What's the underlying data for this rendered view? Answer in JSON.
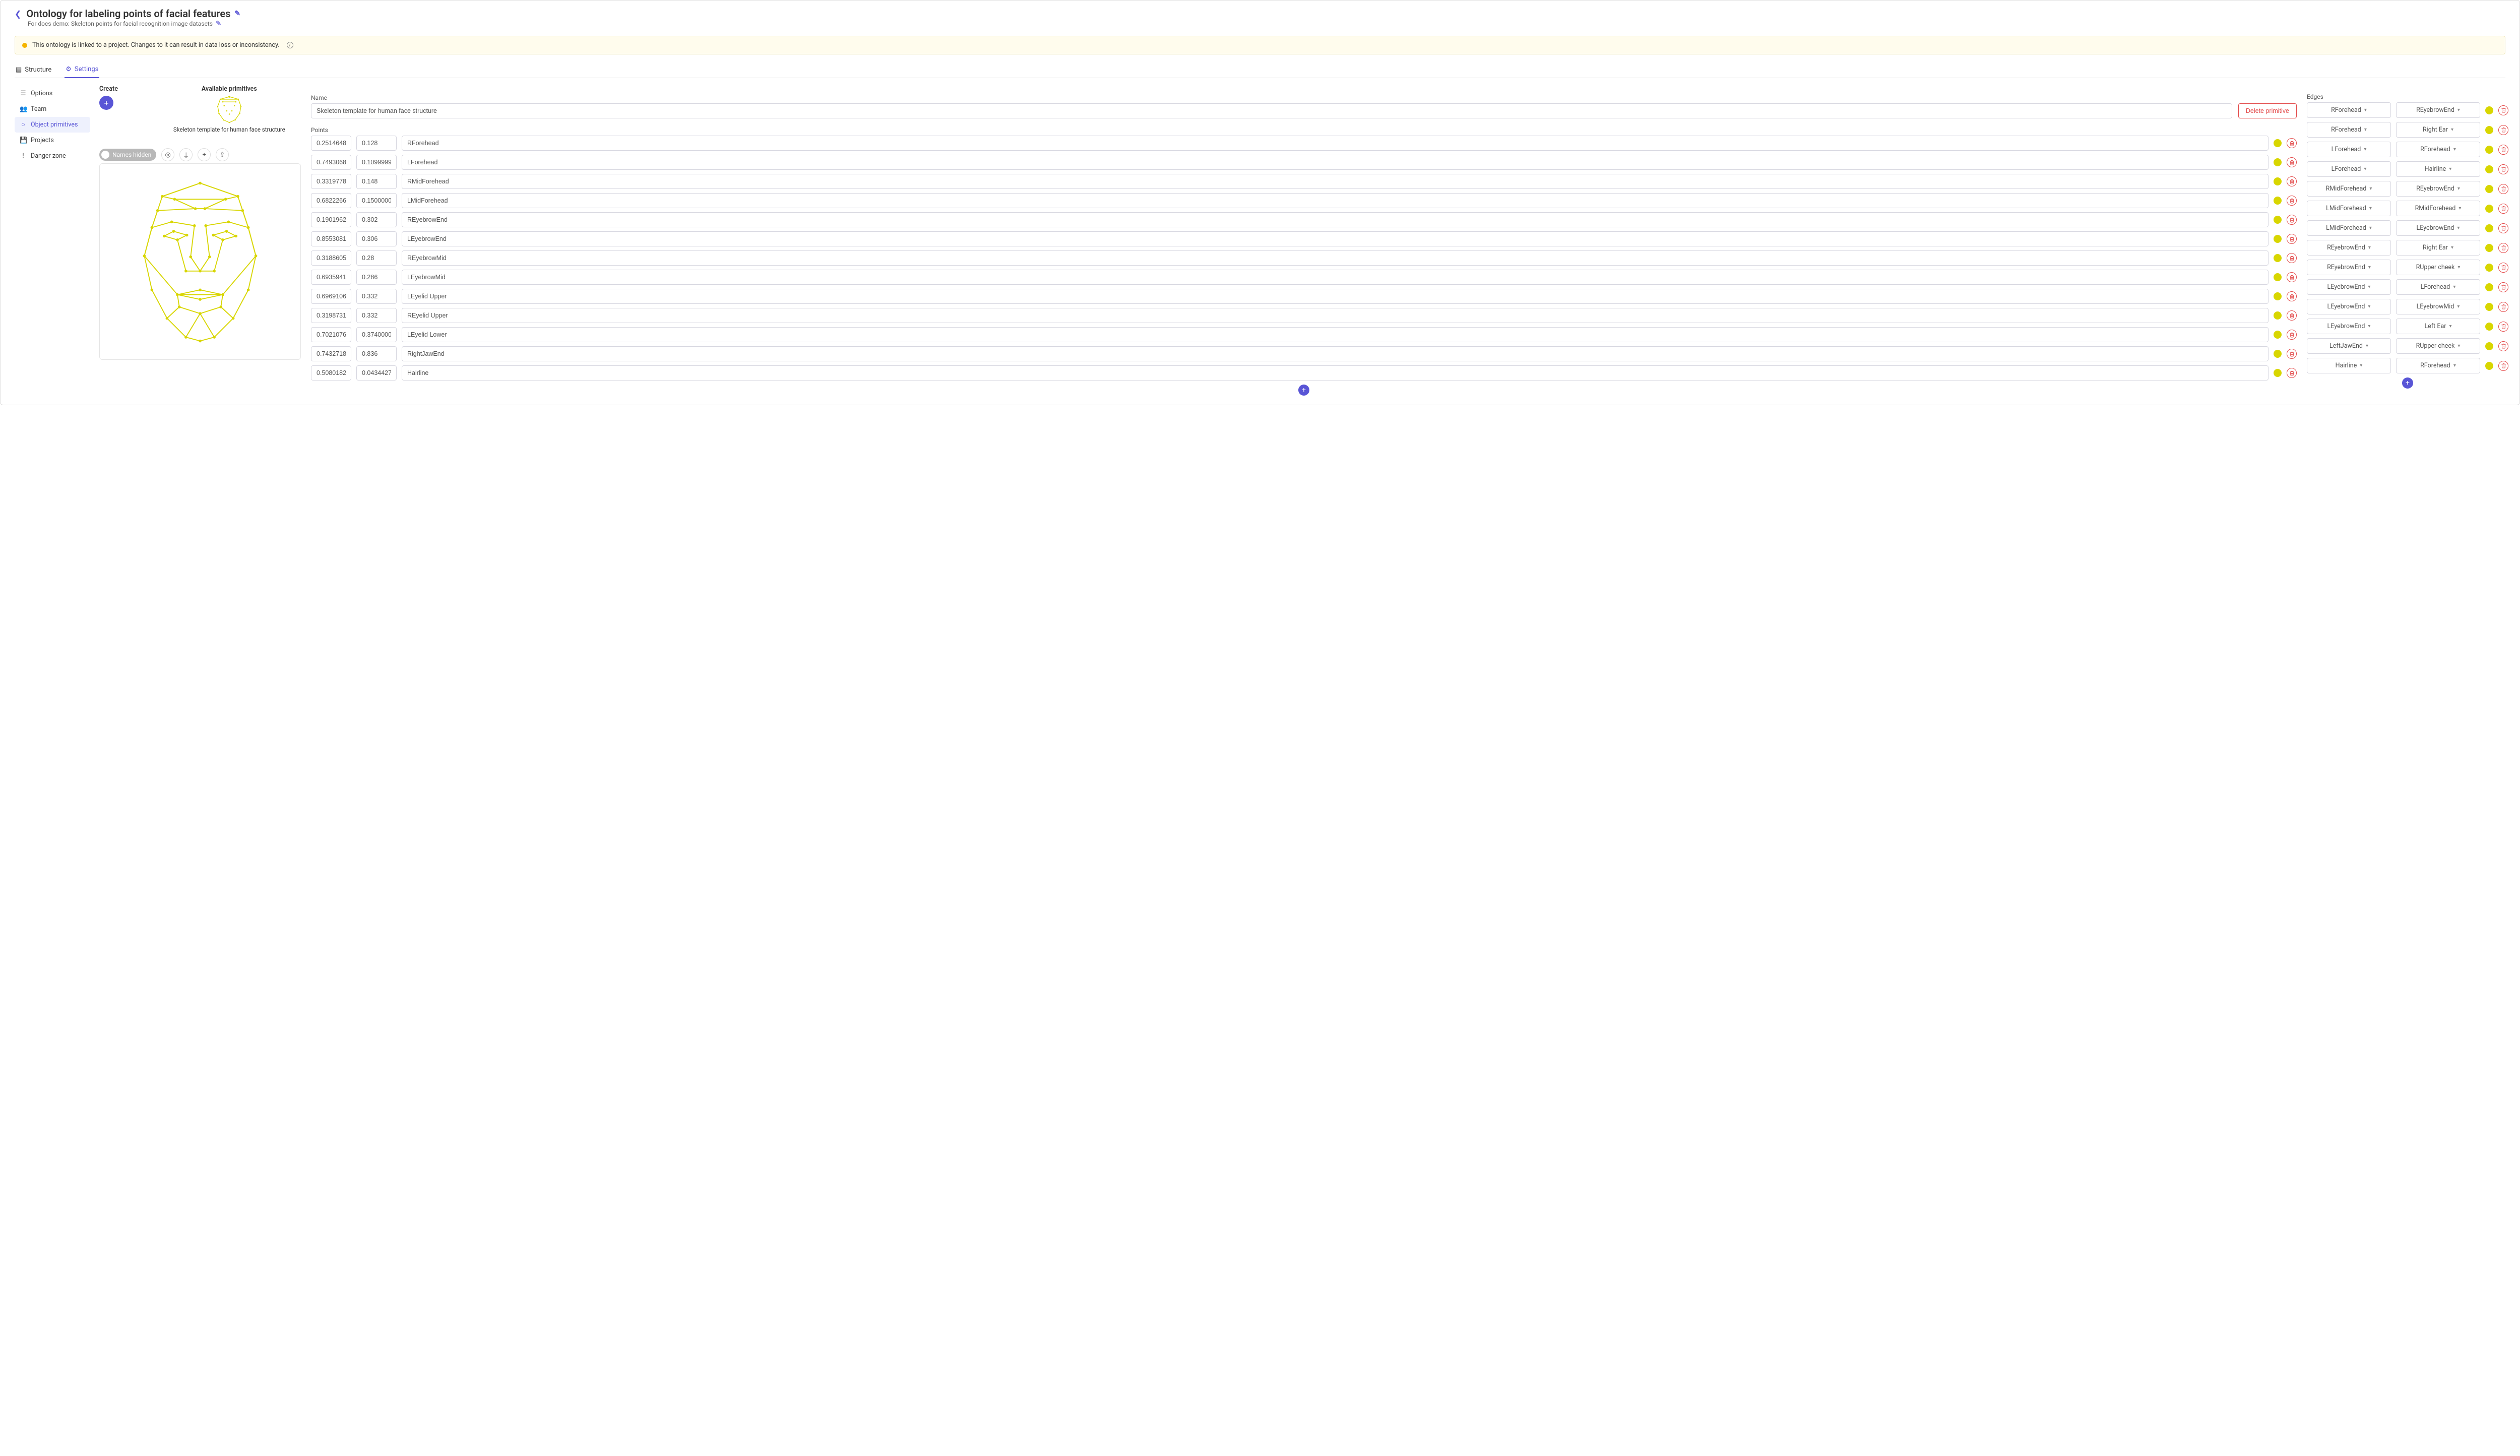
{
  "colors": {
    "accent": "#5955d6",
    "swatch": "#d8d600",
    "danger": "#e34b4b"
  },
  "header": {
    "title": "Ontology for labeling points of facial features",
    "subtitle": "For docs demo: Skeleton points for facial recognition image datasets"
  },
  "warning": {
    "text": "This ontology is linked to a project. Changes to it can result in data loss or inconsistency."
  },
  "tabs": {
    "structure": "Structure",
    "settings": "Settings"
  },
  "sidebar": {
    "options": "Options",
    "team": "Team",
    "object_primitives": "Object primitives",
    "projects": "Projects",
    "danger_zone": "Danger zone"
  },
  "sections": {
    "create": "Create",
    "available": "Available primitives",
    "available_caption": "Skeleton template for human face structure",
    "names_hidden": "Names hidden",
    "name_label": "Name",
    "points_label": "Points",
    "edges_label": "Edges",
    "delete_primitive": "Delete primitive",
    "name_value": "Skeleton template for human face structure"
  },
  "points": [
    {
      "x": "0.251464846",
      "y": "0.128",
      "name": "RForehead"
    },
    {
      "x": "0.749306852",
      "y": "0.109999999",
      "name": "LForehead"
    },
    {
      "x": "0.331977872",
      "y": "0.148",
      "name": "RMidForehead"
    },
    {
      "x": "0.682226630",
      "y": "0.150000000",
      "name": "LMidForehead"
    },
    {
      "x": "0.190196257",
      "y": "0.302",
      "name": "REyebrowEnd"
    },
    {
      "x": "0.855308195",
      "y": "0.306",
      "name": "LEyebrowEnd"
    },
    {
      "x": "0.318860577",
      "y": "0.28",
      "name": "REyebrowMid"
    },
    {
      "x": "0.693594137",
      "y": "0.286",
      "name": "LEyebrowMid"
    },
    {
      "x": "0.696910670",
      "y": "0.332",
      "name": "LEyelid Upper"
    },
    {
      "x": "0.319873152",
      "y": "0.332",
      "name": "REyelid Upper"
    },
    {
      "x": "0.702107616",
      "y": "0.374000000",
      "name": "LEyelid Lower"
    },
    {
      "x": "0.743271802",
      "y": "0.836",
      "name": "RightJawEnd"
    },
    {
      "x": "0.508018249",
      "y": "0.043442718",
      "name": "Hairline"
    }
  ],
  "edges": [
    {
      "a": "RForehead",
      "b": "REyebrowEnd"
    },
    {
      "a": "RForehead",
      "b": "Right Ear"
    },
    {
      "a": "LForehead",
      "b": "RForehead"
    },
    {
      "a": "LForehead",
      "b": "Hairline"
    },
    {
      "a": "RMidForehead",
      "b": "REyebrowEnd"
    },
    {
      "a": "LMidForehead",
      "b": "RMidForehead"
    },
    {
      "a": "LMidForehead",
      "b": "LEyebrowEnd"
    },
    {
      "a": "REyebrowEnd",
      "b": "Right Ear"
    },
    {
      "a": "REyebrowEnd",
      "b": "RUpper cheek"
    },
    {
      "a": "LEyebrowEnd",
      "b": "LForehead"
    },
    {
      "a": "LEyebrowEnd",
      "b": "LEyebrowMid"
    },
    {
      "a": "LEyebrowEnd",
      "b": "Left Ear"
    },
    {
      "a": "LeftJawEnd",
      "b": "RUpper cheek"
    },
    {
      "a": "Hairline",
      "b": "RForehead"
    }
  ]
}
